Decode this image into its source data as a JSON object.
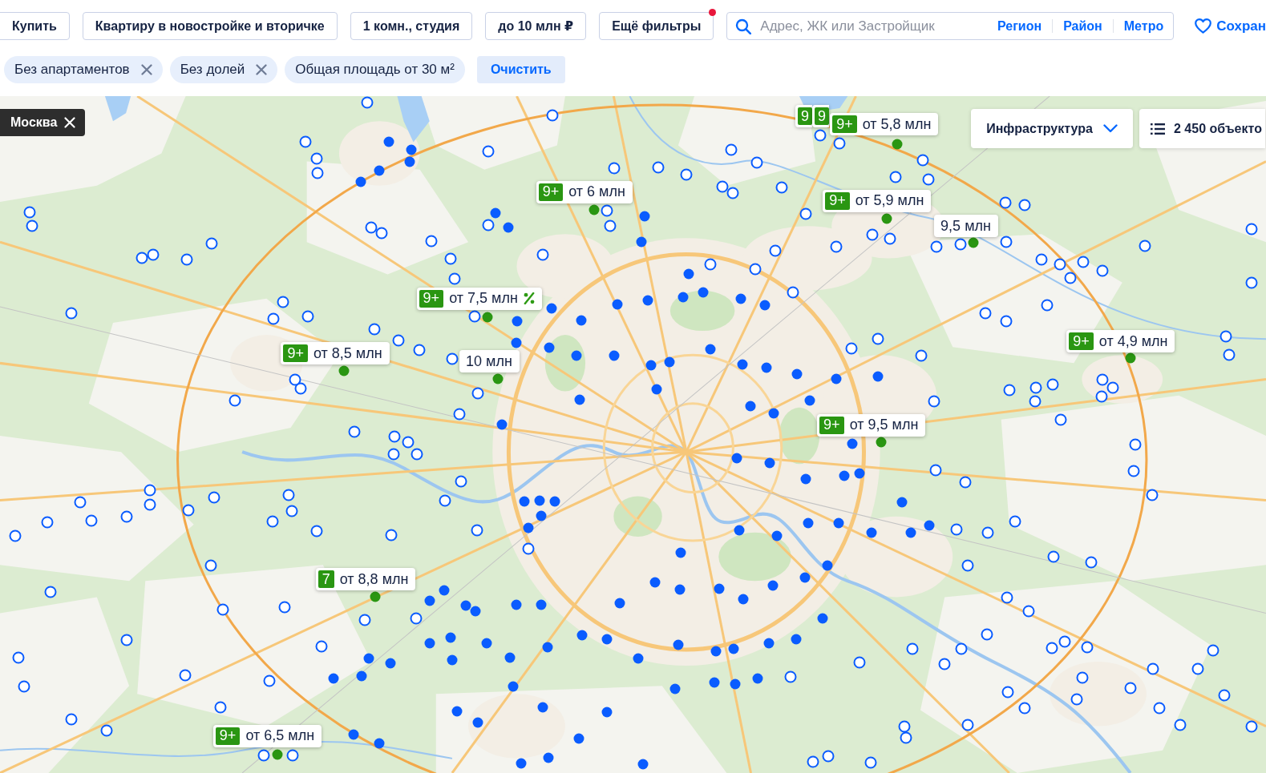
{
  "filters": [
    {
      "label": "Купить",
      "indicator": false
    },
    {
      "label": "Квартиру в новостройке и вторичке",
      "indicator": false
    },
    {
      "label": "1 комн., студия",
      "indicator": false
    },
    {
      "label": "до 10 млн ₽",
      "indicator": false
    },
    {
      "label": "Ещё фильтры",
      "indicator": true
    }
  ],
  "search": {
    "placeholder": "Адрес, ЖК или Застройщик",
    "links": [
      "Регион",
      "Район",
      "Метро"
    ]
  },
  "save": {
    "label": "Сохран"
  },
  "chips": [
    {
      "label": "Без апартаментов",
      "removable": true
    },
    {
      "label": "Без долей",
      "removable": true
    },
    {
      "label": "Общая площадь от 30 м²",
      "removable": false
    }
  ],
  "clear_button": "Очистить",
  "map": {
    "region": "Москва",
    "infrastructure": "Инфраструктура",
    "objects": "2 450 объекто",
    "price_labels": [
      {
        "badge": "9"
      },
      {
        "badge": "9"
      },
      {
        "badge": "9+",
        "text": "от 5,8 млн",
        "discount": false
      },
      {
        "badge": "9+",
        "text": "от 6 млн",
        "discount": false
      },
      {
        "badge": "9+",
        "text": "от 5,9 млн",
        "discount": false
      },
      {
        "text": "9,5 млн",
        "discount": false
      },
      {
        "badge": "9+",
        "text": "от 7,5 млн",
        "discount": true
      },
      {
        "badge": "9+",
        "text": "от 4,9 млн",
        "discount": false
      },
      {
        "badge": "9+",
        "text": "от 8,5 млн",
        "discount": false
      },
      {
        "text": "10 млн",
        "discount": false
      },
      {
        "badge": "9+",
        "text": "от 9,5 млн",
        "discount": false
      },
      {
        "badge": "7",
        "text": "от 8,8 млн",
        "discount": false
      },
      {
        "badge": "9+",
        "text": "от 6,5 млн",
        "discount": false
      }
    ],
    "markers": [
      {
        "kind": "filled"
      },
      {
        "kind": "filled"
      },
      {
        "kind": "filled"
      },
      {
        "kind": "filled"
      },
      {
        "kind": "filled"
      },
      {
        "kind": "filled"
      },
      {
        "kind": "filled"
      },
      {
        "kind": "filled"
      },
      {
        "kind": "filled"
      },
      {
        "kind": "filled"
      },
      {
        "kind": "filled"
      },
      {
        "kind": "filled"
      },
      {
        "kind": "filled"
      },
      {
        "kind": "filled"
      },
      {
        "kind": "filled"
      },
      {
        "kind": "filled"
      },
      {
        "kind": "filled"
      },
      {
        "kind": "filled"
      },
      {
        "kind": "filled"
      },
      {
        "kind": "filled"
      },
      {
        "kind": "filled"
      },
      {
        "kind": "filled"
      },
      {
        "kind": "filled"
      },
      {
        "kind": "filled"
      },
      {
        "kind": "filled"
      },
      {
        "kind": "filled"
      },
      {
        "kind": "filled"
      },
      {
        "kind": "filled"
      },
      {
        "kind": "filled"
      },
      {
        "kind": "filled"
      },
      {
        "kind": "filled"
      },
      {
        "kind": "filled"
      },
      {
        "kind": "filled"
      },
      {
        "kind": "filled"
      },
      {
        "kind": "filled"
      },
      {
        "kind": "filled"
      },
      {
        "kind": "filled"
      },
      {
        "kind": "filled"
      },
      {
        "kind": "filled"
      },
      {
        "kind": "filled"
      },
      {
        "kind": "filled"
      },
      {
        "kind": "filled"
      },
      {
        "kind": "filled"
      },
      {
        "kind": "filled"
      },
      {
        "kind": "filled"
      },
      {
        "kind": "filled"
      },
      {
        "kind": "filled"
      },
      {
        "kind": "filled"
      },
      {
        "kind": "filled"
      },
      {
        "kind": "filled"
      },
      {
        "kind": "filled"
      },
      {
        "kind": "filled"
      },
      {
        "kind": "filled"
      },
      {
        "kind": "filled"
      },
      {
        "kind": "filled"
      },
      {
        "kind": "filled"
      },
      {
        "kind": "filled"
      },
      {
        "kind": "filled"
      },
      {
        "kind": "filled"
      },
      {
        "kind": "filled"
      },
      {
        "kind": "filled"
      },
      {
        "kind": "filled"
      },
      {
        "kind": "filled"
      },
      {
        "kind": "filled"
      },
      {
        "kind": "filled"
      },
      {
        "kind": "filled"
      },
      {
        "kind": "filled"
      },
      {
        "kind": "filled"
      },
      {
        "kind": "filled"
      },
      {
        "kind": "filled"
      },
      {
        "kind": "filled"
      },
      {
        "kind": "filled"
      },
      {
        "kind": "filled"
      },
      {
        "kind": "filled"
      },
      {
        "kind": "filled"
      },
      {
        "kind": "filled"
      },
      {
        "kind": "filled"
      },
      {
        "kind": "filled"
      },
      {
        "kind": "filled"
      },
      {
        "kind": "filled"
      },
      {
        "kind": "filled"
      },
      {
        "kind": "filled"
      },
      {
        "kind": "filled"
      },
      {
        "kind": "filled"
      },
      {
        "kind": "filled"
      },
      {
        "kind": "filled"
      },
      {
        "kind": "filled"
      },
      {
        "kind": "filled"
      },
      {
        "kind": "filled"
      },
      {
        "kind": "filled"
      },
      {
        "kind": "filled"
      },
      {
        "kind": "filled"
      },
      {
        "kind": "filled"
      },
      {
        "kind": "filled"
      },
      {
        "kind": "filled"
      },
      {
        "kind": "filled"
      },
      {
        "kind": "filled"
      },
      {
        "kind": "filled"
      },
      {
        "kind": "filled"
      },
      {
        "kind": "filled"
      },
      {
        "kind": "filled"
      },
      {
        "kind": "filled"
      },
      {
        "kind": "filled"
      },
      {
        "kind": "filled"
      },
      {
        "kind": "filled"
      },
      {
        "kind": "hollow"
      },
      {
        "kind": "hollow"
      },
      {
        "kind": "hollow"
      },
      {
        "kind": "hollow"
      },
      {
        "kind": "hollow"
      },
      {
        "kind": "hollow"
      },
      {
        "kind": "hollow"
      },
      {
        "kind": "hollow"
      },
      {
        "kind": "hollow"
      },
      {
        "kind": "hollow"
      },
      {
        "kind": "hollow"
      },
      {
        "kind": "hollow"
      },
      {
        "kind": "hollow"
      },
      {
        "kind": "hollow"
      },
      {
        "kind": "hollow"
      },
      {
        "kind": "hollow"
      },
      {
        "kind": "hollow"
      },
      {
        "kind": "hollow"
      },
      {
        "kind": "hollow"
      },
      {
        "kind": "hollow"
      },
      {
        "kind": "hollow"
      },
      {
        "kind": "hollow"
      },
      {
        "kind": "hollow"
      },
      {
        "kind": "hollow"
      },
      {
        "kind": "hollow"
      },
      {
        "kind": "hollow"
      },
      {
        "kind": "hollow"
      },
      {
        "kind": "hollow"
      },
      {
        "kind": "hollow"
      },
      {
        "kind": "hollow"
      },
      {
        "kind": "hollow"
      },
      {
        "kind": "hollow"
      },
      {
        "kind": "hollow"
      },
      {
        "kind": "hollow"
      },
      {
        "kind": "hollow"
      },
      {
        "kind": "hollow"
      },
      {
        "kind": "hollow"
      },
      {
        "kind": "hollow"
      },
      {
        "kind": "hollow"
      },
      {
        "kind": "hollow"
      },
      {
        "kind": "hollow"
      },
      {
        "kind": "hollow"
      },
      {
        "kind": "hollow"
      },
      {
        "kind": "hollow"
      },
      {
        "kind": "hollow"
      },
      {
        "kind": "hollow"
      },
      {
        "kind": "hollow"
      },
      {
        "kind": "hollow"
      },
      {
        "kind": "hollow"
      },
      {
        "kind": "hollow"
      },
      {
        "kind": "hollow"
      },
      {
        "kind": "hollow"
      },
      {
        "kind": "hollow"
      },
      {
        "kind": "hollow"
      },
      {
        "kind": "hollow"
      },
      {
        "kind": "hollow"
      },
      {
        "kind": "hollow"
      },
      {
        "kind": "hollow"
      },
      {
        "kind": "hollow"
      },
      {
        "kind": "hollow"
      },
      {
        "kind": "hollow"
      },
      {
        "kind": "hollow"
      },
      {
        "kind": "hollow"
      },
      {
        "kind": "hollow"
      },
      {
        "kind": "hollow"
      },
      {
        "kind": "hollow"
      },
      {
        "kind": "hollow"
      },
      {
        "kind": "hollow"
      },
      {
        "kind": "hollow"
      },
      {
        "kind": "hollow"
      },
      {
        "kind": "hollow"
      },
      {
        "kind": "hollow"
      },
      {
        "kind": "hollow"
      },
      {
        "kind": "hollow"
      },
      {
        "kind": "hollow"
      },
      {
        "kind": "hollow"
      },
      {
        "kind": "hollow"
      },
      {
        "kind": "hollow"
      },
      {
        "kind": "hollow"
      },
      {
        "kind": "hollow"
      },
      {
        "kind": "hollow"
      },
      {
        "kind": "hollow"
      },
      {
        "kind": "hollow"
      },
      {
        "kind": "hollow"
      },
      {
        "kind": "hollow"
      },
      {
        "kind": "hollow"
      },
      {
        "kind": "hollow"
      },
      {
        "kind": "hollow"
      },
      {
        "kind": "hollow"
      },
      {
        "kind": "hollow"
      },
      {
        "kind": "hollow"
      },
      {
        "kind": "hollow"
      },
      {
        "kind": "hollow"
      },
      {
        "kind": "hollow"
      },
      {
        "kind": "hollow"
      },
      {
        "kind": "hollow"
      },
      {
        "kind": "hollow"
      },
      {
        "kind": "hollow"
      },
      {
        "kind": "hollow"
      },
      {
        "kind": "hollow"
      },
      {
        "kind": "hollow"
      },
      {
        "kind": "hollow"
      },
      {
        "kind": "hollow"
      },
      {
        "kind": "hollow"
      },
      {
        "kind": "hollow"
      },
      {
        "kind": "hollow"
      },
      {
        "kind": "hollow"
      },
      {
        "kind": "hollow"
      },
      {
        "kind": "hollow"
      },
      {
        "kind": "hollow"
      },
      {
        "kind": "hollow"
      },
      {
        "kind": "hollow"
      },
      {
        "kind": "hollow"
      },
      {
        "kind": "hollow"
      },
      {
        "kind": "hollow"
      },
      {
        "kind": "hollow"
      },
      {
        "kind": "hollow"
      },
      {
        "kind": "hollow"
      },
      {
        "kind": "hollow"
      },
      {
        "kind": "hollow"
      },
      {
        "kind": "hollow"
      },
      {
        "kind": "hollow"
      },
      {
        "kind": "hollow"
      },
      {
        "kind": "hollow"
      },
      {
        "kind": "hollow"
      },
      {
        "kind": "hollow"
      },
      {
        "kind": "hollow"
      },
      {
        "kind": "hollow"
      },
      {
        "kind": "hollow"
      },
      {
        "kind": "hollow"
      },
      {
        "kind": "hollow"
      },
      {
        "kind": "hollow"
      },
      {
        "kind": "hollow"
      },
      {
        "kind": "hollow"
      },
      {
        "kind": "hollow"
      },
      {
        "kind": "hollow"
      },
      {
        "kind": "hollow"
      },
      {
        "kind": "hollow"
      },
      {
        "kind": "hollow"
      },
      {
        "kind": "hollow"
      },
      {
        "kind": "hollow"
      },
      {
        "kind": "hollow"
      },
      {
        "kind": "hollow"
      },
      {
        "kind": "hollow"
      },
      {
        "kind": "hollow"
      },
      {
        "kind": "hollow"
      },
      {
        "kind": "hollow"
      },
      {
        "kind": "hollow"
      },
      {
        "kind": "hollow"
      },
      {
        "kind": "hollow"
      },
      {
        "kind": "hollow"
      },
      {
        "kind": "hollow"
      },
      {
        "kind": "hollow"
      },
      {
        "kind": "hollow"
      },
      {
        "kind": "hollow"
      },
      {
        "kind": "hollow"
      },
      {
        "kind": "hollow"
      },
      {
        "kind": "hollow"
      },
      {
        "kind": "hollow"
      },
      {
        "kind": "hollow"
      },
      {
        "kind": "hollow"
      },
      {
        "kind": "hollow"
      },
      {
        "kind": "hollow"
      },
      {
        "kind": "hollow"
      },
      {
        "kind": "hollow"
      },
      {
        "kind": "hollow"
      },
      {
        "kind": "anchor"
      },
      {
        "kind": "anchor"
      },
      {
        "kind": "anchor"
      },
      {
        "kind": "anchor"
      },
      {
        "kind": "anchor"
      },
      {
        "kind": "anchor"
      },
      {
        "kind": "anchor"
      },
      {
        "kind": "anchor"
      },
      {
        "kind": "anchor"
      },
      {
        "kind": "anchor"
      },
      {
        "kind": "anchor"
      }
    ]
  }
}
